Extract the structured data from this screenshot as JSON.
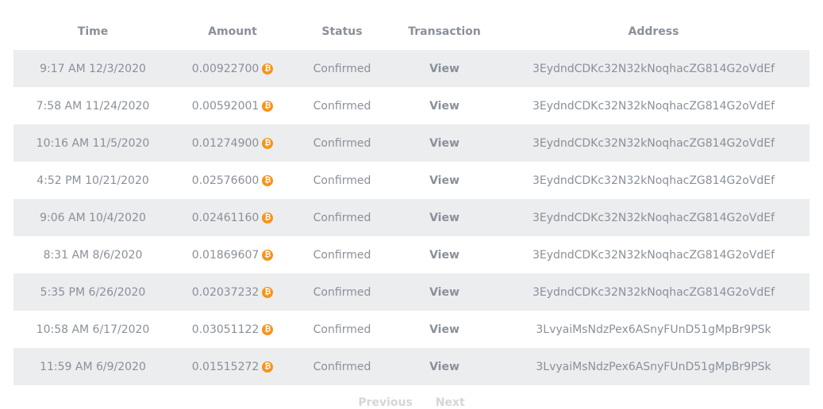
{
  "table": {
    "headers": {
      "time": "Time",
      "amount": "Amount",
      "status": "Status",
      "transaction": "Transaction",
      "address": "Address"
    },
    "rows": [
      {
        "time": "9:17 AM 12/3/2020",
        "amount": "0.00922700",
        "status": "Confirmed",
        "transaction": "View",
        "address": "3EydndCDKc32N32kNoqhacZG814G2oVdEf"
      },
      {
        "time": "7:58 AM 11/24/2020",
        "amount": "0.00592001",
        "status": "Confirmed",
        "transaction": "View",
        "address": "3EydndCDKc32N32kNoqhacZG814G2oVdEf"
      },
      {
        "time": "10:16 AM 11/5/2020",
        "amount": "0.01274900",
        "status": "Confirmed",
        "transaction": "View",
        "address": "3EydndCDKc32N32kNoqhacZG814G2oVdEf"
      },
      {
        "time": "4:52 PM 10/21/2020",
        "amount": "0.02576600",
        "status": "Confirmed",
        "transaction": "View",
        "address": "3EydndCDKc32N32kNoqhacZG814G2oVdEf"
      },
      {
        "time": "9:06 AM 10/4/2020",
        "amount": "0.02461160",
        "status": "Confirmed",
        "transaction": "View",
        "address": "3EydndCDKc32N32kNoqhacZG814G2oVdEf"
      },
      {
        "time": "8:31 AM 8/6/2020",
        "amount": "0.01869607",
        "status": "Confirmed",
        "transaction": "View",
        "address": "3EydndCDKc32N32kNoqhacZG814G2oVdEf"
      },
      {
        "time": "5:35 PM 6/26/2020",
        "amount": "0.02037232",
        "status": "Confirmed",
        "transaction": "View",
        "address": "3EydndCDKc32N32kNoqhacZG814G2oVdEf"
      },
      {
        "time": "10:58 AM 6/17/2020",
        "amount": "0.03051122",
        "status": "Confirmed",
        "transaction": "View",
        "address": "3LvyaiMsNdzPex6ASnyFUnD51gMpBr9PSk"
      },
      {
        "time": "11:59 AM 6/9/2020",
        "amount": "0.01515272",
        "status": "Confirmed",
        "transaction": "View",
        "address": "3LvyaiMsNdzPex6ASnyFUnD51gMpBr9PSk"
      }
    ]
  },
  "pagination": {
    "previous": "Previous",
    "next": "Next"
  },
  "icons": {
    "currency": "bitcoin-icon",
    "currency_glyph": "₿"
  },
  "colors": {
    "row_shade": "#ebedef",
    "text": "#8a9099",
    "bitcoin": "#f7931a",
    "pager_disabled": "#d3d6da"
  }
}
